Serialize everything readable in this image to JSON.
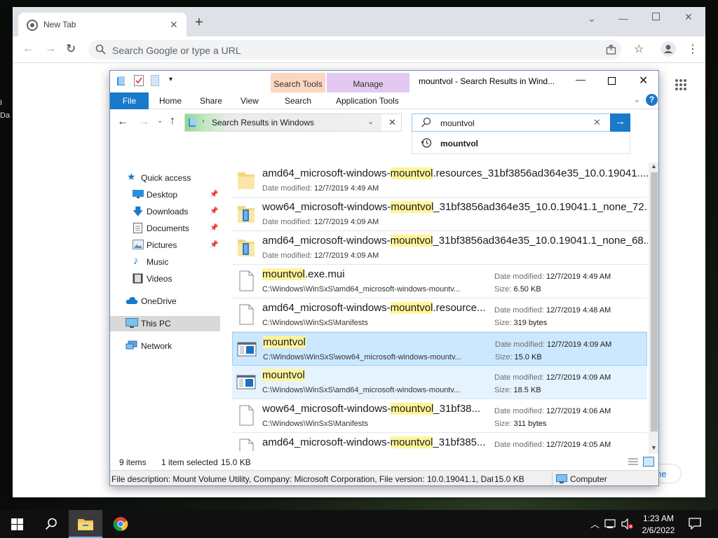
{
  "chrome": {
    "tab_title": "New Tab",
    "omnibox_placeholder": "Search Google or type a URL",
    "partial_button_label": "rome"
  },
  "explorer": {
    "window_title": "mountvol - Search Results in Wind...",
    "context_tabs": {
      "search_group": "Search Tools",
      "manage_group": "Manage"
    },
    "ribbon_tabs": [
      "File",
      "Home",
      "Share",
      "View",
      "Search",
      "Application Tools"
    ],
    "address": "Search Results in Windows",
    "search_value": "mountvol",
    "suggestion": "mountvol",
    "nav": {
      "quick_access": "Quick access",
      "desktop": "Desktop",
      "downloads": "Downloads",
      "documents": "Documents",
      "pictures": "Pictures",
      "music": "Music",
      "videos": "Videos",
      "onedrive": "OneDrive",
      "this_pc": "This PC",
      "network": "Network"
    },
    "date_label": "Date modified:",
    "size_label": "Size:",
    "results": [
      {
        "pre": "amd64_microsoft-windows-",
        "hl": "mountvol",
        "post": ".resources_31bf3856ad364e35_10.0.19041....",
        "sub": "12/7/2019 4:49 AM",
        "type": "folder",
        "layout": "folder"
      },
      {
        "pre": "wow64_microsoft-windows-",
        "hl": "mountvol",
        "post": "_31bf3856ad364e35_10.0.19041.1_none_72...",
        "sub": "12/7/2019 4:09 AM",
        "type": "folder-blue",
        "layout": "folder"
      },
      {
        "pre": "amd64_microsoft-windows-",
        "hl": "mountvol",
        "post": "_31bf3856ad364e35_10.0.19041.1_none_68...",
        "sub": "12/7/2019 4:09 AM",
        "type": "folder-blue",
        "layout": "folder"
      },
      {
        "pre": "",
        "hl": "mountvol",
        "post": ".exe.mui",
        "sub": "C:\\Windows\\WinSxS\\amd64_microsoft-windows-mountv...",
        "date": "12/7/2019 4:49 AM",
        "size": "6.50 KB",
        "type": "file",
        "layout": "file"
      },
      {
        "pre": "amd64_microsoft-windows-",
        "hl": "mountvol",
        "post": ".resource...",
        "sub": "C:\\Windows\\WinSxS\\Manifests",
        "date": "12/7/2019 4:48 AM",
        "size": "319 bytes",
        "type": "file",
        "layout": "file"
      },
      {
        "pre": "",
        "hl": "mountvol",
        "post": "",
        "sub": "C:\\Windows\\WinSxS\\wow64_microsoft-windows-mountv...",
        "date": "12/7/2019 4:09 AM",
        "size": "15.0 KB",
        "type": "exe",
        "layout": "file",
        "state": "selected"
      },
      {
        "pre": "",
        "hl": "mountvol",
        "post": "",
        "sub": "C:\\Windows\\WinSxS\\amd64_microsoft-windows-mountv...",
        "date": "12/7/2019 4:09 AM",
        "size": "18.5 KB",
        "type": "exe",
        "layout": "file",
        "state": "hover"
      },
      {
        "pre": "wow64_microsoft-windows-",
        "hl": "mountvol",
        "post": "_31bf38...",
        "sub": "C:\\Windows\\WinSxS\\Manifests",
        "date": "12/7/2019 4:06 AM",
        "size": "311 bytes",
        "type": "file",
        "layout": "file"
      },
      {
        "pre": "amd64_microsoft-windows-",
        "hl": "mountvol",
        "post": "_31bf385...",
        "sub": "",
        "date": "12/7/2019 4:05 AM",
        "size": "",
        "type": "file",
        "layout": "file"
      }
    ],
    "status": {
      "items": "9 items",
      "selected": "1 item selected",
      "size": "15.0 KB"
    },
    "details": {
      "description": "File description: Mount Volume Utility, Company: Microsoft Corporation, File version: 10.0.19041.1, Date",
      "size": "15.0 KB",
      "location": "Computer"
    }
  },
  "taskbar": {
    "time": "1:23 AM",
    "date": "2/6/2022"
  },
  "desktop": {
    "partial_labels": [
      "I",
      "Da",
      "I",
      "I"
    ]
  },
  "colors": {
    "accent": "#1979ca",
    "highlight": "#fff59a",
    "selected_row": "#cce8ff"
  }
}
